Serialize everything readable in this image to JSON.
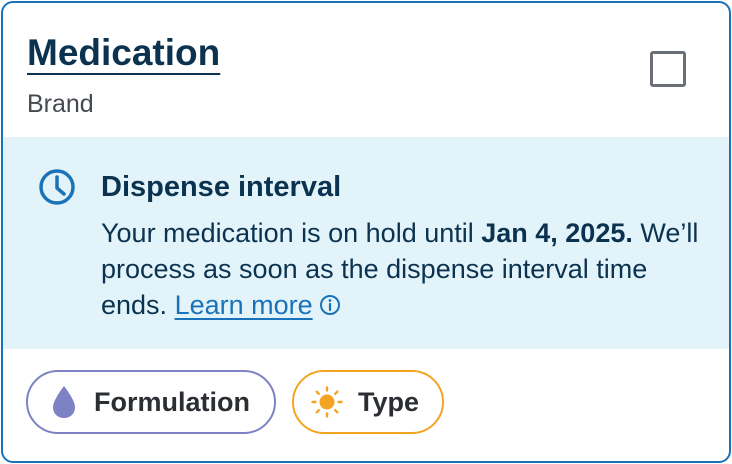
{
  "card": {
    "title": "Medication",
    "subtitle": "Brand",
    "checkbox_checked": false
  },
  "banner": {
    "icon": "clock-icon",
    "title": "Dispense interval",
    "body_before": "Your medication is on hold until ",
    "body_bold": "Jan 4, 2025.",
    "body_after": " We’ll process as soon as the dispense interval time ends. ",
    "link_label": "Learn more",
    "info_icon": "info-icon"
  },
  "chips": [
    {
      "label": "Formulation",
      "icon": "droplet-icon",
      "color": "#7d82c4"
    },
    {
      "label": "Type",
      "icon": "sun-icon",
      "color": "#f2a522"
    }
  ],
  "colors": {
    "card_border": "#1a73b8",
    "title": "#0b3350",
    "banner_bg": "#e3f3fa",
    "link": "#1a73b8"
  }
}
